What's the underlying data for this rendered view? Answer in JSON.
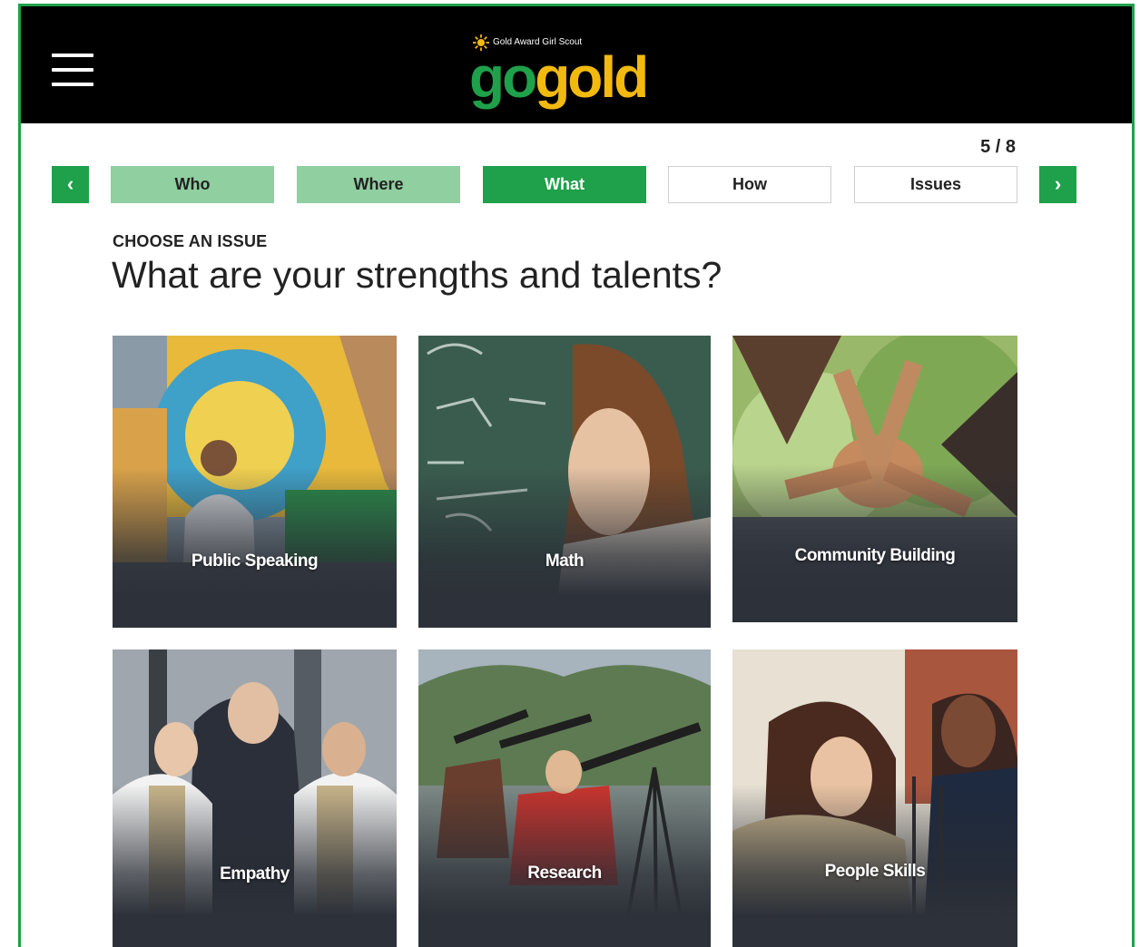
{
  "header": {
    "menu_icon": "hamburger-menu-icon",
    "logo_subtitle": "Gold Award Girl Scout",
    "logo_go": "go",
    "logo_gold": "gold",
    "brand_green": "#1fa04a",
    "brand_gold": "#f2b90f"
  },
  "progress": {
    "counter": "5 / 8",
    "current": 5,
    "total": 8
  },
  "nav": {
    "prev_icon": "chevron-left-icon",
    "next_icon": "chevron-right-icon",
    "prev_label": "‹",
    "next_label": "›",
    "tabs": [
      {
        "label": "Who",
        "state": "done"
      },
      {
        "label": "Where",
        "state": "done"
      },
      {
        "label": "What",
        "state": "active"
      },
      {
        "label": "How",
        "state": "todo"
      },
      {
        "label": "Issues",
        "state": "todo"
      }
    ]
  },
  "main": {
    "eyebrow": "CHOOSE AN ISSUE",
    "heading": "What are your strengths and talents?",
    "cards": [
      {
        "label": "Public Speaking",
        "image": "girl speaking into microphone on parade float"
      },
      {
        "label": "Math",
        "image": "girl at chalkboard with equations"
      },
      {
        "label": "Community Building",
        "image": "hands stacked together in a circle"
      },
      {
        "label": "Empathy",
        "image": "three girl scouts smiling together"
      },
      {
        "label": "Research",
        "image": "girls looking through telescopes"
      },
      {
        "label": "People Skills",
        "image": "girl scout writing with adult mentor"
      }
    ]
  }
}
